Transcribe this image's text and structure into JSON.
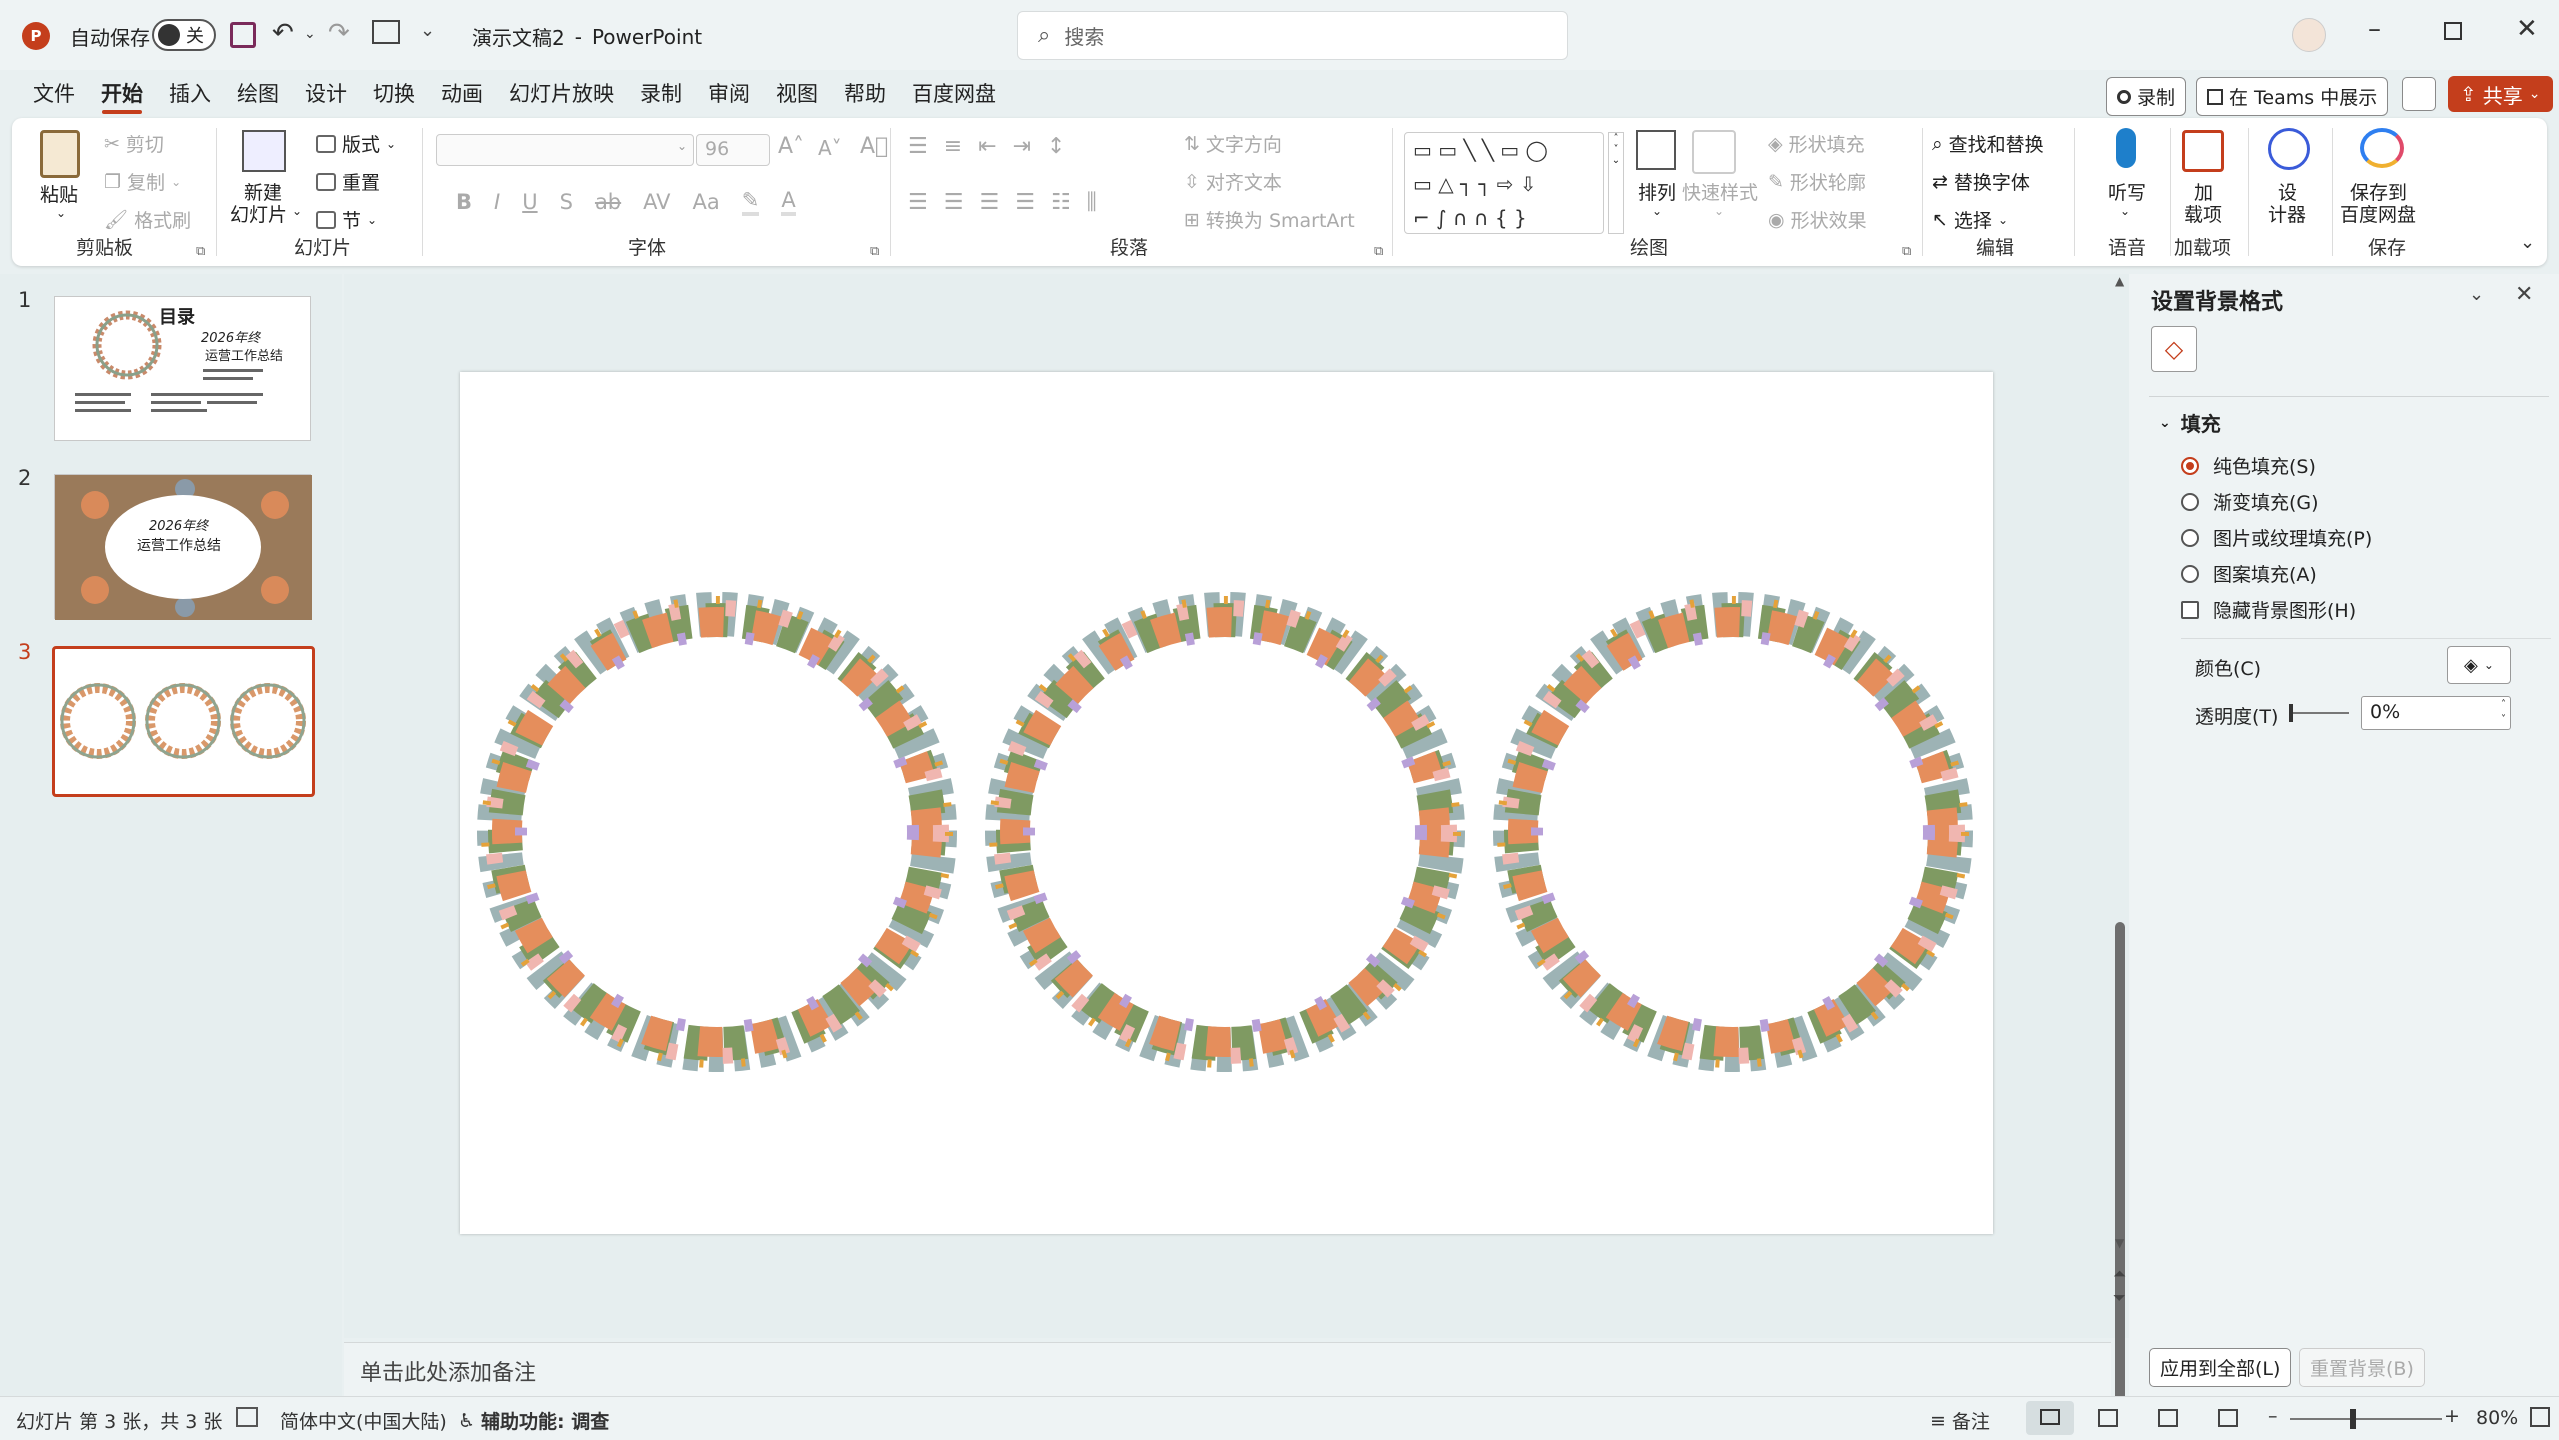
{
  "titlebar": {
    "autosave_label": "自动保存",
    "autosave_state": "关",
    "doc_title": "演示文稿2",
    "separator": "-",
    "app_name": "PowerPoint",
    "search_placeholder": "搜索"
  },
  "menu": {
    "tabs": [
      "文件",
      "开始",
      "插入",
      "绘图",
      "设计",
      "切换",
      "动画",
      "幻灯片放映",
      "录制",
      "审阅",
      "视图",
      "帮助",
      "百度网盘"
    ],
    "active_tab": "开始",
    "record_label": "录制",
    "teams_label": "在 Teams 中展示",
    "share_label": "共享"
  },
  "ribbon": {
    "clipboard": {
      "paste": "粘贴",
      "cut": "剪切",
      "copy": "复制",
      "format_painter": "格式刷",
      "label": "剪贴板"
    },
    "slides": {
      "new_slide_1": "新建",
      "new_slide_2": "幻灯片",
      "layout": "版式",
      "reset": "重置",
      "section": "节",
      "label": "幻灯片"
    },
    "font": {
      "font_size": "96",
      "label": "字体",
      "bold": "B",
      "italic": "I",
      "underline": "U",
      "strike": "S",
      "abc": "ab",
      "spacing": "AV",
      "case": "Aa"
    },
    "paragraph": {
      "text_direction": "文字方向",
      "align_text": "对齐文本",
      "smartart": "转换为 SmartArt",
      "label": "段落"
    },
    "drawing": {
      "arrange": "排列",
      "quick_styles": "快速样式",
      "shape_fill": "形状填充",
      "shape_outline": "形状轮廓",
      "shape_effects": "形状效果",
      "label": "绘图"
    },
    "editing": {
      "find_replace": "查找和替换",
      "replace_font": "替换字体",
      "select": "选择",
      "label": "编辑"
    },
    "voice": {
      "dictate": "听写",
      "label": "语音"
    },
    "addins": {
      "addins_1": "加",
      "addins_2": "载项",
      "label": "加载项"
    },
    "designer": {
      "designer_1": "设",
      "designer_2": "计器"
    },
    "save": {
      "save_1": "保存到",
      "save_2": "百度网盘",
      "label": "保存"
    }
  },
  "thumbnails": [
    {
      "num": "1",
      "title": "目录",
      "subtitle_1": "2026年终",
      "subtitle_2": "运营工作总结"
    },
    {
      "num": "2",
      "subtitle_1": "2026年终",
      "subtitle_2": "运营工作总结"
    },
    {
      "num": "3"
    }
  ],
  "notes_placeholder": "单击此处添加备注",
  "format_pane": {
    "title": "设置背景格式",
    "section": "填充",
    "options": [
      "纯色填充(S)",
      "渐变填充(G)",
      "图片或纹理填充(P)",
      "图案填充(A)"
    ],
    "selected_option": "纯色填充(S)",
    "hide_bg": "隐藏背景图形(H)",
    "color_label": "颜色(C)",
    "transparency_label": "透明度(T)",
    "transparency_value": "0%",
    "apply_all": "应用到全部(L)",
    "reset_bg": "重置背景(B)"
  },
  "statusbar": {
    "slide_info": "幻灯片 第 3 张，共 3 张",
    "language": "简体中文(中国大陆)",
    "accessibility": "辅助功能: 调查",
    "notes": "备注",
    "zoom": "80%"
  },
  "colors": {
    "accent": "#c43e1c",
    "background": "#e9f0f1"
  }
}
